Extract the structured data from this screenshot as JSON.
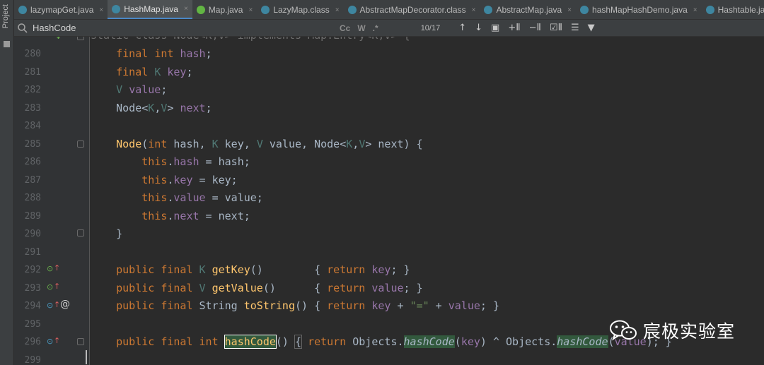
{
  "sidebar": {
    "project_label": "Project"
  },
  "tabs": [
    {
      "label": "lazymapGet.java",
      "icon_color": "#3e86a0",
      "active": false
    },
    {
      "label": "HashMap.java",
      "icon_color": "#3e86a0",
      "active": true
    },
    {
      "label": "Map.java",
      "icon_color": "#62b543",
      "active": false
    },
    {
      "label": "LazyMap.class",
      "icon_color": "#3e86a0",
      "active": false
    },
    {
      "label": "AbstractMapDecorator.class",
      "icon_color": "#3e86a0",
      "active": false
    },
    {
      "label": "AbstractMap.java",
      "icon_color": "#3e86a0",
      "active": false
    },
    {
      "label": "hashMapHashDemo.java",
      "icon_color": "#3e86a0",
      "active": false
    },
    {
      "label": "Hashtable.java",
      "icon_color": "#3e86a0",
      "active": false
    }
  ],
  "tab_close_glyph": "×",
  "find": {
    "value": "HashCode",
    "match_case": "Cc",
    "words": "W",
    "regex": ".*",
    "count": "10/17",
    "buttons": [
      "↑",
      "↓",
      "▣",
      "+Ⅱ",
      "−Ⅱ",
      "☑Ⅱ",
      "☰",
      "▼"
    ]
  },
  "editor": {
    "line_numbers": [
      "280",
      "281",
      "282",
      "283",
      "284",
      "285",
      "286",
      "287",
      "288",
      "289",
      "290",
      "291",
      "292",
      "293",
      "294",
      "295",
      "296",
      "299"
    ],
    "top_partial_text": "static class Node<K,V> implements Map.Entry<K,V> {"
  },
  "watermark": {
    "text": "宸极实验室"
  },
  "colors": {
    "keyword": "#cc7832",
    "field": "#9876aa",
    "method": "#ffc66d",
    "string": "#6a8759",
    "generic": "#507874",
    "active_tab_underline": "#4a88c7"
  }
}
